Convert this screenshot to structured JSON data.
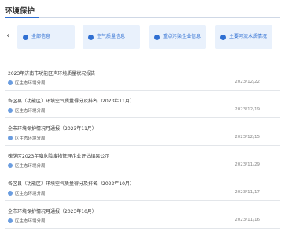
{
  "header": {
    "title": "环境保护"
  },
  "nav": {
    "prev_icon": "chevron-left-icon",
    "prev_glyph": "‹"
  },
  "categories": [
    {
      "label": "全部信息"
    },
    {
      "label": "空气质量信息"
    },
    {
      "label": "重点污染企业信息"
    },
    {
      "label": "主要河流水质情况"
    }
  ],
  "items": [
    {
      "title": "2023年济南市功能区声环境质量状况报告",
      "source": "区生态环境分局",
      "date": "2023/12/22"
    },
    {
      "title": "各区县（功能区）环境空气质量得分及排名（2023年11月）",
      "source": "区生态环境分局",
      "date": "2023/12/19"
    },
    {
      "title": "全市环境保护情况月通报（2023年11月）",
      "source": "区生态环境分局",
      "date": "2023/12/15"
    },
    {
      "title": "槐荫区2023年度危险废物管理企业评估结果公示",
      "source": "区生态环境分局",
      "date": "2023/11/29"
    },
    {
      "title": "各区县（功能区）环境空气质量得分及排名（2023年10月）",
      "source": "区生态环境分局",
      "date": "2023/11/17"
    },
    {
      "title": "全市环境保护情况月通报（2023年10月）",
      "source": "区生态环境分局",
      "date": "2023/11/16"
    }
  ],
  "colors": {
    "accent": "#2f6fd2",
    "card_bg": "#e9f1fc"
  }
}
